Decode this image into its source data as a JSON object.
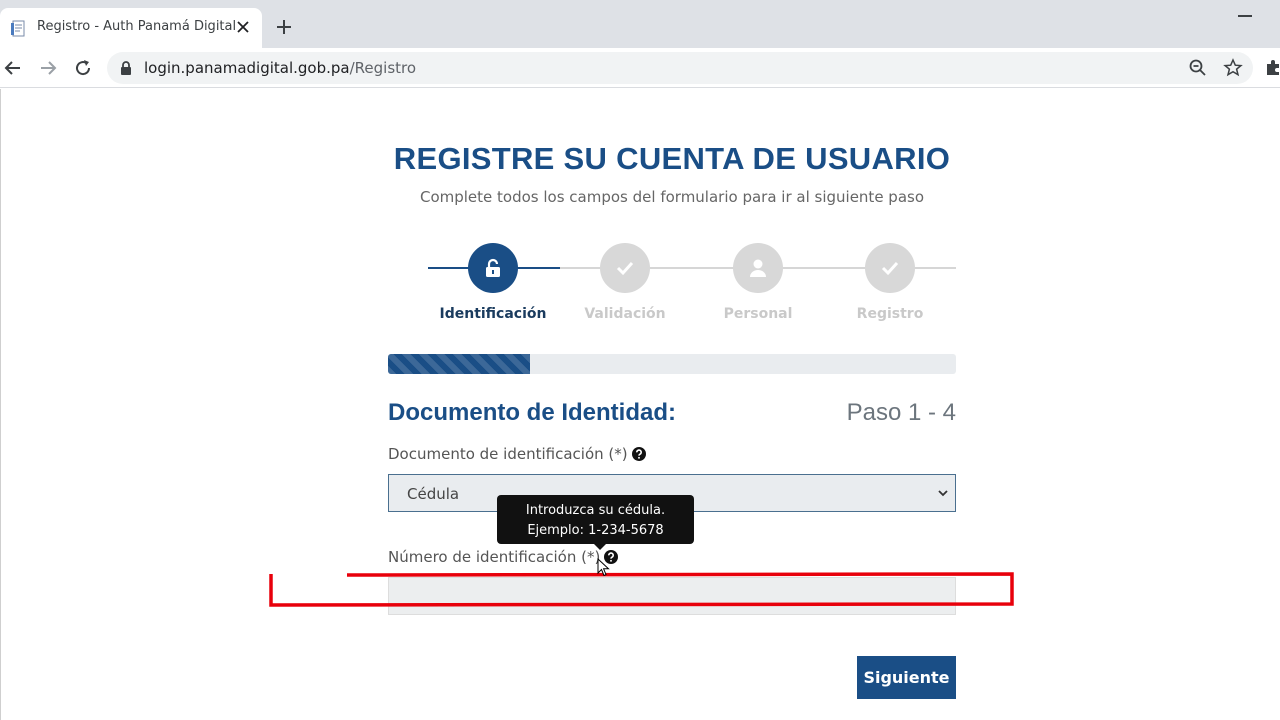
{
  "browser": {
    "tab_title": "Registro - Auth Panamá Digital",
    "url_domain": "login.panamadigital.gob.pa",
    "url_path": "/Registro"
  },
  "header": {
    "title": "REGISTRE SU CUENTA DE USUARIO",
    "subtitle": "Complete todos los campos del formulario para ir al siguiente paso"
  },
  "stepper": {
    "steps": [
      {
        "label": "Identificación",
        "icon": "unlock-icon",
        "active": true
      },
      {
        "label": "Validación",
        "icon": "check-icon",
        "active": false
      },
      {
        "label": "Personal",
        "icon": "user-icon",
        "active": false
      },
      {
        "label": "Registro",
        "icon": "check-icon",
        "active": false
      }
    ]
  },
  "progress": {
    "percent": 25
  },
  "form": {
    "section_title": "Documento de Identidad:",
    "step_count": "Paso 1 - 4",
    "doc_type_label": "Documento de identificación (*)",
    "doc_type_value": "Cédula",
    "id_number_label": "Número de identificación (*)",
    "id_number_value": "",
    "tooltip_line1": "Introduzca su cédula.",
    "tooltip_line2": "Ejemplo: 1-234-5678",
    "next_label": "Siguiente"
  },
  "colors": {
    "primary": "#1a4e86",
    "inactive_step": "#d8d8d8",
    "highlight": "#e8000b"
  }
}
